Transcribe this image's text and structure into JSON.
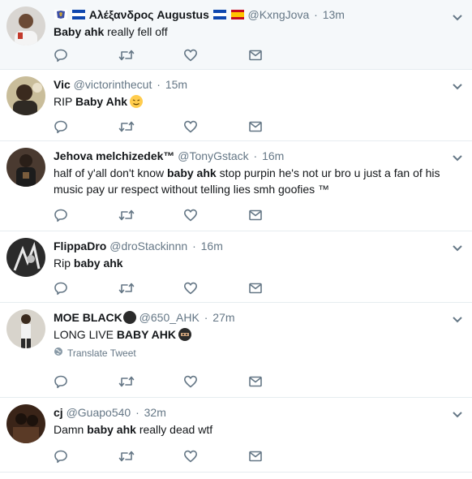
{
  "tweets": [
    {
      "fullname": "Αλέξανδρος Augustus",
      "username": "@KxngJova",
      "time": "13m",
      "text_bold": "Baby ahk",
      "text_after": " really fell off",
      "highlight": true
    },
    {
      "fullname": "Vic",
      "username": "@victorinthecut",
      "time": "15m",
      "text_before": "RIP ",
      "text_bold": "Baby Ahk"
    },
    {
      "fullname": "Jehova melchizedek™",
      "username": "@TonyGstack",
      "time": "16m",
      "text_before": "half of y'all don't know ",
      "text_bold": "baby ahk",
      "text_after": " stop purpin he's not ur bro u just a fan of his music pay ur respect without telling lies smh goofies ™"
    },
    {
      "fullname": "FlippaDro",
      "username": "@droStackinnn",
      "time": "16m",
      "text_before": "Rip ",
      "text_bold": "baby ahk"
    },
    {
      "fullname": "MOE BLACK",
      "username": "@650_AHK",
      "time": "27m",
      "text_before": "LONG LIVE ",
      "text_bold": "BABY AHK",
      "translate": "Translate Tweet"
    },
    {
      "fullname": "cj",
      "username": "@Guapo540",
      "time": "32m",
      "text_before": "Damn ",
      "text_bold": "baby ahk",
      "text_after": " really dead wtf"
    }
  ],
  "header_separator": "·",
  "icons": [
    "reply-icon",
    "retweet-icon",
    "like-icon",
    "direct-message-icon",
    "caret-down-icon",
    "globe-icon"
  ],
  "colors": {
    "text": "#14171a",
    "secondary": "#657786",
    "border": "#e6ecf0",
    "highlight_bg": "#f5f8fa"
  }
}
